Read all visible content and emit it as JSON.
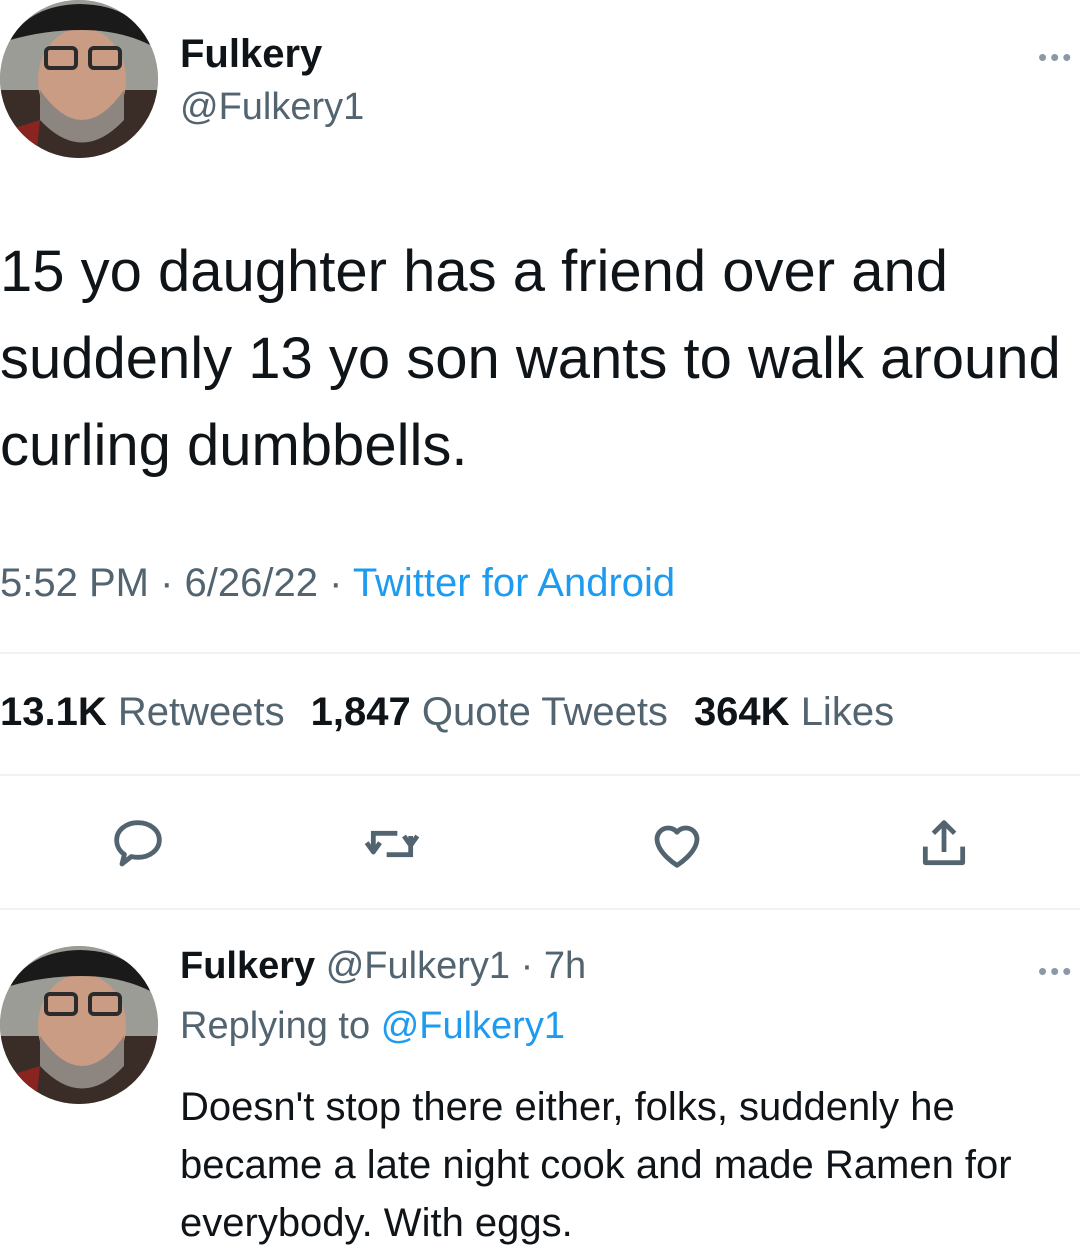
{
  "main_tweet": {
    "author_name": "Fulkery",
    "author_handle": "@Fulkery1",
    "text": "15 yo daughter has a friend over and suddenly 13 yo son wants to walk around curling dumbbells.",
    "time": "5:52 PM",
    "date": "6/26/22",
    "source": "Twitter for Android",
    "separator": " · ",
    "stats": {
      "retweets_count": "13.1K",
      "retweets_label": "Retweets",
      "quotes_count": "1,847",
      "quotes_label": "Quote Tweets",
      "likes_count": "364K",
      "likes_label": "Likes"
    }
  },
  "reply_tweet": {
    "author_name": "Fulkery",
    "author_handle": "@Fulkery1",
    "age": "7h",
    "separator": " · ",
    "replying_prefix": "Replying to",
    "replying_to": "@Fulkery1",
    "text": "Doesn't stop there either, folks, suddenly he became a late night cook and made Ramen for everybody. With eggs."
  },
  "icons": {
    "more": "more-horizontal-icon",
    "reply": "reply-icon",
    "retweet": "retweet-icon",
    "like": "heart-icon",
    "share": "share-icon"
  },
  "colors": {
    "text_primary": "#0f1419",
    "text_secondary": "#536471",
    "accent": "#1d9bf0",
    "divider": "#eff3f4"
  },
  "more_glyph": "•••"
}
